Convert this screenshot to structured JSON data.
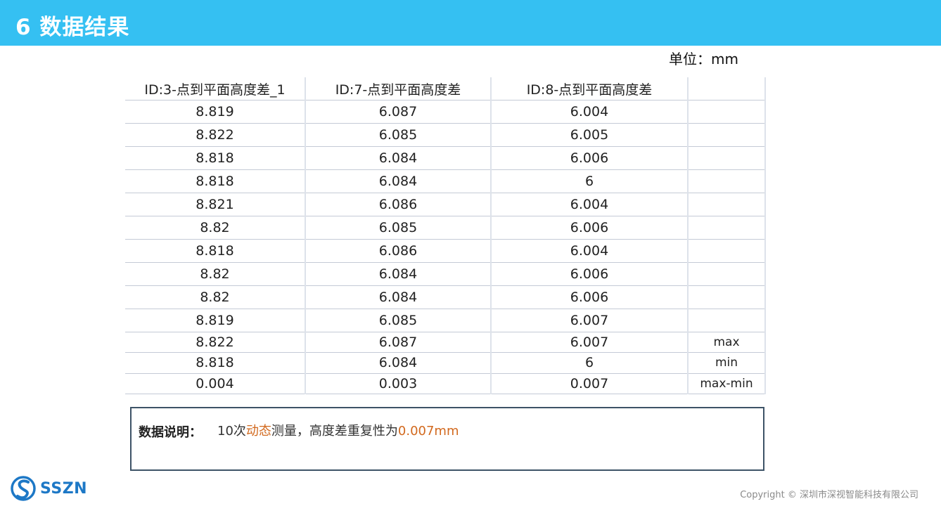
{
  "header": {
    "title": "6 数据结果"
  },
  "unit_label": "单位：mm",
  "table": {
    "headers": [
      "ID:3-点到平面高度差_1",
      "ID:7-点到平面高度差",
      "ID:8-点到平面高度差",
      ""
    ],
    "rows": [
      [
        "8.819",
        "6.087",
        "6.004"
      ],
      [
        "8.822",
        "6.085",
        "6.005"
      ],
      [
        "8.818",
        "6.084",
        "6.006"
      ],
      [
        "8.818",
        "6.084",
        "6"
      ],
      [
        "8.821",
        "6.086",
        "6.004"
      ],
      [
        "8.82",
        "6.085",
        "6.006"
      ],
      [
        "8.818",
        "6.086",
        "6.004"
      ],
      [
        "8.82",
        "6.084",
        "6.006"
      ],
      [
        "8.82",
        "6.084",
        "6.006"
      ],
      [
        "8.819",
        "6.085",
        "6.007"
      ]
    ],
    "stats": [
      {
        "values": [
          "8.822",
          "6.087",
          "6.007"
        ],
        "label": "max"
      },
      {
        "values": [
          "8.818",
          "6.084",
          "6"
        ],
        "label": "min"
      },
      {
        "values": [
          "0.004",
          "0.003",
          "0.007"
        ],
        "label": "max-min"
      }
    ]
  },
  "note": {
    "label": "数据说明：",
    "text_part1": "10次",
    "text_highlight1": "动态",
    "text_part2": "测量，高度差重复性为",
    "text_highlight2": "0.007mm"
  },
  "logo": {
    "text": "SSZN"
  },
  "copyright": "Copyright © 深圳市深视智能科技有限公司",
  "colors": {
    "header_bg": "#35c0f2",
    "highlight": "#d2691e",
    "logo_blue": "#1d78c6"
  }
}
